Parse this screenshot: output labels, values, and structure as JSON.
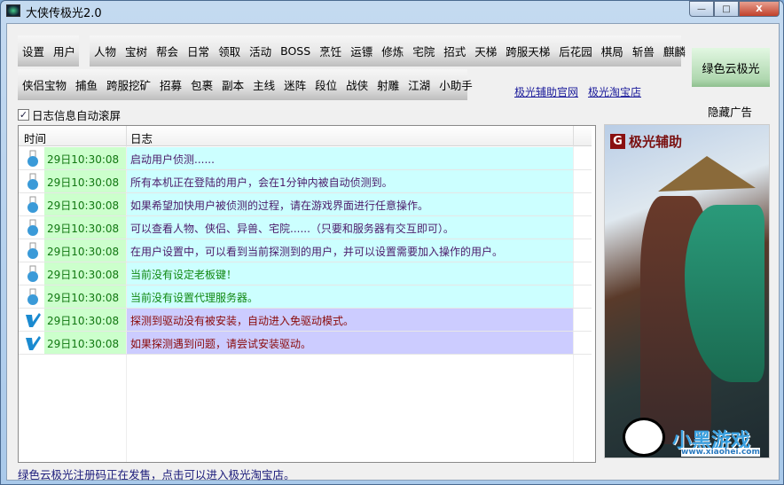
{
  "window": {
    "title": "大侠传极光2.0",
    "min": "—",
    "max": "□",
    "close": "X"
  },
  "toolbar": {
    "group1": [
      "设置",
      "用户"
    ],
    "group2": [
      "人物",
      "宝树",
      "帮会",
      "日常",
      "领取",
      "活动",
      "BOSS",
      "烹饪",
      "运镖",
      "修炼",
      "宅院",
      "招式",
      "天梯",
      "跨服天梯",
      "后花园",
      "棋局",
      "斩兽",
      "麒麟"
    ],
    "group3": [
      "侠侣宝物",
      "捕鱼",
      "跨服挖矿",
      "招募",
      "包裹",
      "副本",
      "主线",
      "迷阵",
      "段位",
      "战侠",
      "射雕",
      "江湖",
      "小助手"
    ]
  },
  "green_button": "绿色云极光",
  "links": {
    "official": "极光辅助官网",
    "taobao": "极光淘宝店"
  },
  "hide_ad": "隐藏广告",
  "auto_scroll": {
    "label": "日志信息自动滚屏",
    "checked": true,
    "mark": "✓"
  },
  "log": {
    "headers": {
      "time": "时间",
      "log": "日志"
    },
    "rows": [
      {
        "time": "29日10:30:08",
        "msg": "启动用户侦测......"
      },
      {
        "time": "29日10:30:08",
        "msg": "所有本机正在登陆的用户，会在1分钟内被自动侦测到。"
      },
      {
        "time": "29日10:30:08",
        "msg": "如果希望加快用户被侦测的过程，请在游戏界面进行任意操作。"
      },
      {
        "time": "29日10:30:08",
        "msg": "可以查看人物、侠侣、异兽、宅院......（只要和服务器有交互即可）。"
      },
      {
        "time": "29日10:30:08",
        "msg": "在用户设置中，可以看到当前探测到的用户，并可以设置需要加入操作的用户。"
      },
      {
        "time": "29日10:30:08",
        "msg": "当前没有设定老板键！"
      },
      {
        "time": "29日10:30:08",
        "msg": "当前没有设置代理服务器。"
      },
      {
        "time": "29日10:30:08",
        "msg": "探测到驱动没有被安装，自动进入免驱动模式。"
      },
      {
        "time": "29日10:30:08",
        "msg": "如果探测遇到问题，请尝试安装驱动。"
      }
    ]
  },
  "ad": {
    "brand_icon": "G",
    "brand": "极光辅助",
    "watermark": "小黑游戏",
    "url": "www.xiaohei.com"
  },
  "status": "绿色云极光注册码正在发售，点击可以进入极光淘宝店。"
}
